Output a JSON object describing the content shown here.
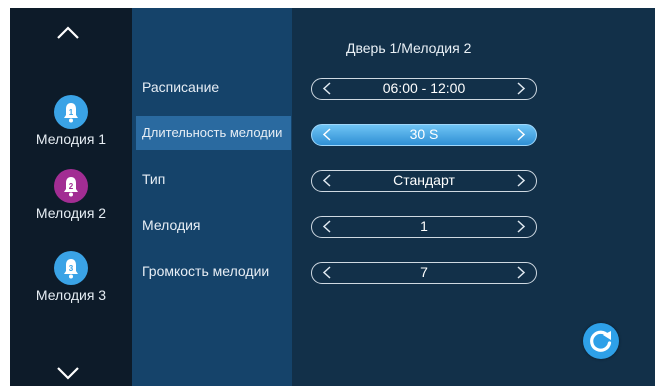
{
  "header": {
    "title": "Дверь 1/Мелодия 2"
  },
  "sidebar": {
    "tones": [
      {
        "label": "Мелодия 1",
        "number": "1",
        "color": "#3aa3e6"
      },
      {
        "label": "Мелодия 2",
        "number": "2",
        "color": "#a22d93"
      },
      {
        "label": "Мелодия 3",
        "number": "3",
        "color": "#3aa3e6"
      }
    ]
  },
  "settings": [
    {
      "label": "Расписание",
      "value": "06:00 - 12:00",
      "active": false
    },
    {
      "label": "Длительность мелодии",
      "value": "30 S",
      "active": true
    },
    {
      "label": "Тип",
      "value": "Стандарт",
      "active": false
    },
    {
      "label": "Мелодия",
      "value": "1",
      "active": false
    },
    {
      "label": "Громкость мелодии",
      "value": "7",
      "active": false
    }
  ],
  "colors": {
    "rail_background": "#0d1b29",
    "label_column_background": "#15436a",
    "content_background": "#123049",
    "highlight": "#2a6aa0",
    "accent": "#2ea0e8"
  },
  "icons": {
    "scroll_up": "chevron-up-icon",
    "scroll_down": "chevron-down-icon",
    "tone": "bell-icon",
    "prev": "chevron-left-icon",
    "next": "chevron-right-icon",
    "reset": "refresh-icon"
  }
}
